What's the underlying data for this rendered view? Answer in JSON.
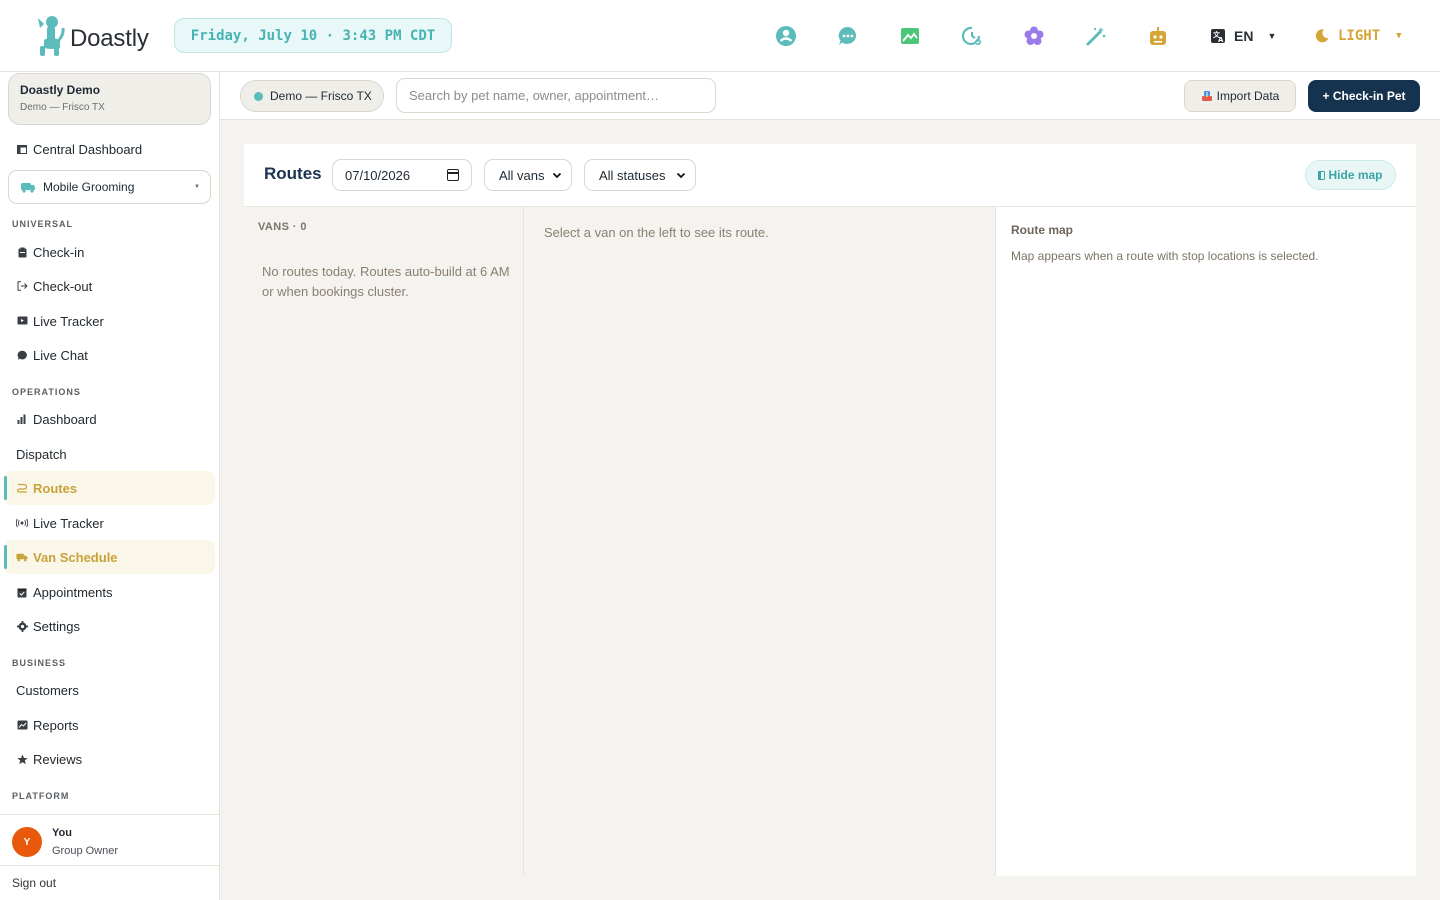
{
  "app": {
    "name": "Doastly"
  },
  "header": {
    "datetime": "Friday, July 10 · 3:43 PM CDT",
    "language": "EN",
    "theme": "LIGHT",
    "icons": [
      "support-icon",
      "chat-icon",
      "image-icon",
      "clock-icon",
      "flower-icon",
      "magic-wand-icon",
      "robot-icon"
    ],
    "colors": {
      "teal": "#5cbcbc",
      "green": "#4cc77a",
      "purple": "#9b7bea",
      "gold": "#d4a537"
    }
  },
  "sidebar": {
    "org_name": "Doastly Demo",
    "org_sub": "Demo — Frisco TX",
    "central_dashboard": "Central Dashboard",
    "module": "Mobile Grooming",
    "sections": {
      "universal": "UNIVERSAL",
      "operations": "OPERATIONS",
      "business": "BUSINESS",
      "platform": "PLATFORM"
    },
    "universal_items": [
      "Check-in",
      "Check-out",
      "Live Tracker",
      "Live Chat"
    ],
    "operations_items": [
      "Dashboard",
      "Dispatch",
      "Routes",
      "Live Tracker",
      "Van Schedule",
      "Appointments",
      "Settings"
    ],
    "business_items": [
      "Customers",
      "Reports",
      "Reviews"
    ],
    "user": {
      "initial": "Y",
      "name": "You",
      "role": "Group Owner"
    },
    "signout": "Sign out"
  },
  "toolbar": {
    "location": "Demo — Frisco TX",
    "search_placeholder": "Search by pet name, owner, appointment…",
    "import_label": "Import Data",
    "checkin_label": "+ Check-in Pet"
  },
  "routes": {
    "title": "Routes",
    "date": "07/10/2026",
    "van_filter": "All vans",
    "status_filter": "All statuses",
    "hide_map": "Hide map",
    "vans_label": "VANS · 0",
    "vans_empty": "No routes today. Routes auto-build at 6 AM or when bookings cluster.",
    "route_empty": "Select a van on the left to see its route.",
    "map_title": "Route map",
    "map_hint": "Map appears when a route with stop locations is selected."
  }
}
